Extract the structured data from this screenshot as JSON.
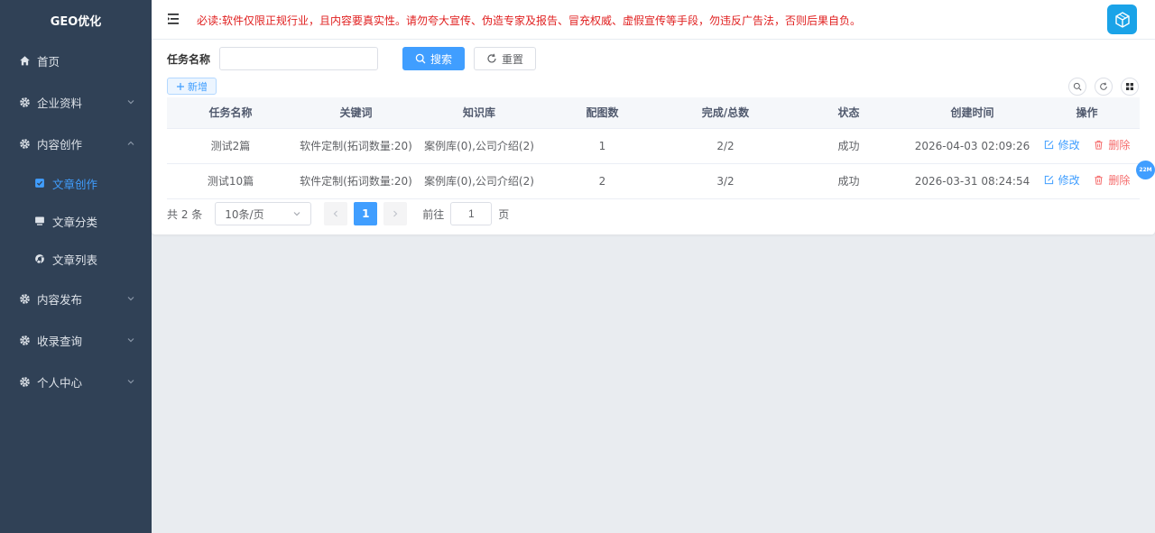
{
  "sidebar": {
    "logo": "GEO优化",
    "items": [
      {
        "label": "首页",
        "icon": "home-icon"
      },
      {
        "label": "企业资料",
        "icon": "gear-icon"
      },
      {
        "label": "内容创作",
        "icon": "gear-icon",
        "expanded": true,
        "children": [
          {
            "label": "文章创作",
            "icon": "check-square-icon",
            "active": true
          },
          {
            "label": "文章分类",
            "icon": "monitor-icon"
          },
          {
            "label": "文章列表",
            "icon": "chrome-icon"
          }
        ]
      },
      {
        "label": "内容发布",
        "icon": "gear-icon"
      },
      {
        "label": "收录查询",
        "icon": "gear-icon"
      },
      {
        "label": "个人中心",
        "icon": "gear-icon"
      }
    ]
  },
  "topbar": {
    "notice": "必读:软件仅限正规行业，且内容要真实性。请勿夸大宣传、伪造专家及报告、冒充权威、虚假宣传等手段，勿违反广告法，否则后果自负。"
  },
  "search": {
    "label": "任务名称",
    "value": "",
    "search_label": "搜索",
    "reset_label": "重置"
  },
  "toolbar": {
    "add_label": "新增"
  },
  "table": {
    "headers": [
      "任务名称",
      "关键词",
      "知识库",
      "配图数",
      "完成/总数",
      "状态",
      "创建时间",
      "操作"
    ],
    "rows": [
      {
        "name": "测试2篇",
        "keyword": "软件定制(拓词数量:20)",
        "kb": "案例库(0),公司介绍(2)",
        "images": "1",
        "progress": "2/2",
        "status": "成功",
        "created": "2026-04-03 02:09:26"
      },
      {
        "name": "测试10篇",
        "keyword": "软件定制(拓词数量:20)",
        "kb": "案例库(0),公司介绍(2)",
        "images": "2",
        "progress": "3/2",
        "status": "成功",
        "created": "2026-03-31 08:24:54"
      }
    ],
    "edit_label": "修改",
    "delete_label": "删除"
  },
  "pagination": {
    "total_text": "共 2 条",
    "page_size": "10条/页",
    "current_page": "1",
    "goto_label": "前往",
    "goto_value": "1",
    "page_unit": "页"
  },
  "float_badge": "22M",
  "colors": {
    "sidebar_bg": "#304156",
    "accent": "#409eff",
    "danger": "#f56c6c",
    "notice": "#e02020"
  }
}
